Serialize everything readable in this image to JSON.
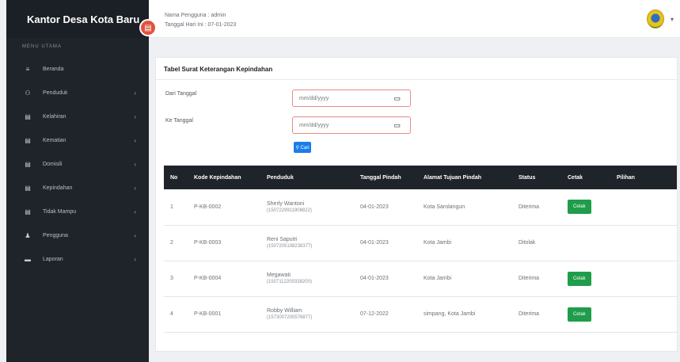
{
  "sidebar": {
    "brand": "Kantor Desa Kota Baru",
    "section_header": "MENU UTAMA",
    "items": [
      {
        "label": "Beranda",
        "icon": "≡",
        "has_children": false
      },
      {
        "label": "Penduduk",
        "icon": "⚇",
        "has_children": true
      },
      {
        "label": "Kelahiran",
        "icon": "▤",
        "has_children": true
      },
      {
        "label": "Kematian",
        "icon": "▤",
        "has_children": true
      },
      {
        "label": "Domisili",
        "icon": "▤",
        "has_children": true
      },
      {
        "label": "Kepindahan",
        "icon": "▤",
        "has_children": true
      },
      {
        "label": "Tidak Mampu",
        "icon": "▤",
        "has_children": true
      },
      {
        "label": "Pengguna",
        "icon": "♟",
        "has_children": true
      },
      {
        "label": "Laporan",
        "icon": "▬",
        "has_children": true
      }
    ]
  },
  "topbar": {
    "user_line": "Nama Pengguna : admin",
    "date_line": "Tanggal Hari Ini : 07-01-2023"
  },
  "card": {
    "title": "Tabel Surat Keterangan Kepindahan",
    "filter_from_label": "Dari Tanggal",
    "filter_to_label": "Ke Tanggal",
    "date_placeholder": "mm/dd/yyyy",
    "search_label": "⚲ Cari"
  },
  "table": {
    "headers": [
      "No",
      "Kode Kepindahan",
      "Penduduk",
      "Tanggal Pindah",
      "Alamat Tujuan Pindah",
      "Status",
      "Cetak",
      "Pilihan"
    ],
    "rows": [
      {
        "no": "1",
        "kode": "P-KB-0002",
        "nama": "Sherly Wantoni",
        "nik": "(1507229911908822)",
        "tanggal": "04-01-2023",
        "alamat": "Kota Sarolangun",
        "status": "Diterima",
        "cetak": "Cetak"
      },
      {
        "no": "2",
        "kode": "P-KB-0003",
        "nama": "Reni Saputri",
        "nik": "(1507205108238377)",
        "tanggal": "04-01-2023",
        "alamat": "Kota Jambi",
        "status": "Ditolak",
        "cetak": ""
      },
      {
        "no": "3",
        "kode": "P-KB-0004",
        "nama": "Megawati",
        "nik": "(1507112200338200)",
        "tanggal": "04-01-2023",
        "alamat": "Kota Jambi",
        "status": "Diterima",
        "cetak": "Cetak"
      },
      {
        "no": "4",
        "kode": "P-KB-0001",
        "nama": "Robby William",
        "nik": "(1573007200576877)",
        "tanggal": "07-12-2022",
        "alamat": "simpang, Kota Jambi",
        "status": "Diterima",
        "cetak": "Cetak"
      }
    ]
  }
}
